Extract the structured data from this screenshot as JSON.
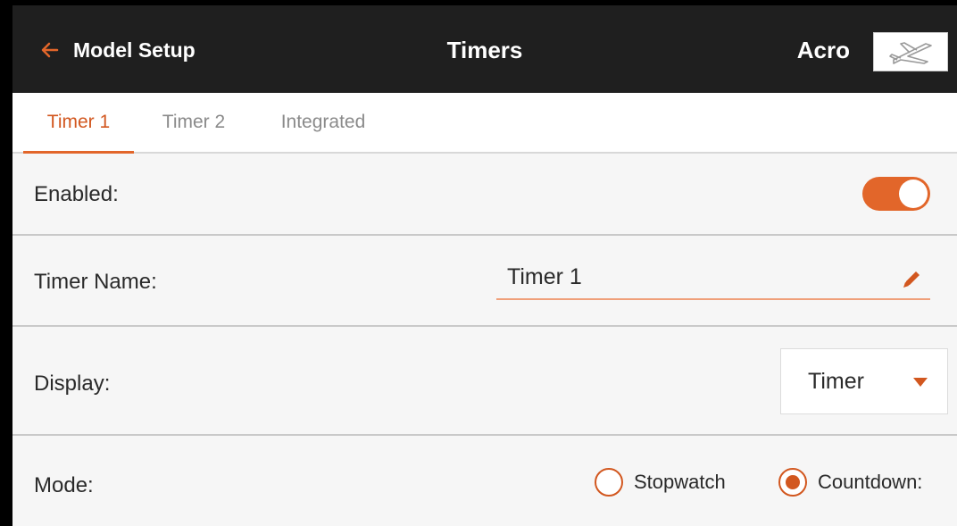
{
  "header": {
    "back_label": "Model Setup",
    "title": "Timers",
    "model_name": "Acro",
    "model_icon": "airplane-icon"
  },
  "tabs": [
    {
      "label": "Timer 1",
      "active": true
    },
    {
      "label": "Timer 2",
      "active": false
    },
    {
      "label": "Integrated",
      "active": false
    }
  ],
  "rows": {
    "enabled": {
      "label": "Enabled:",
      "value": true
    },
    "timer_name": {
      "label": "Timer Name:",
      "value": "Timer 1",
      "icon": "pencil-icon"
    },
    "display": {
      "label": "Display:",
      "selected": "Timer"
    },
    "mode": {
      "label": "Mode:",
      "options": [
        {
          "label": "Stopwatch",
          "checked": false
        },
        {
          "label": "Countdown:",
          "checked": true
        }
      ]
    }
  },
  "colors": {
    "accent": "#e2662a",
    "header_bg": "#1f1f1f",
    "row_bg": "#f6f6f6",
    "divider": "#c9c9c9"
  }
}
